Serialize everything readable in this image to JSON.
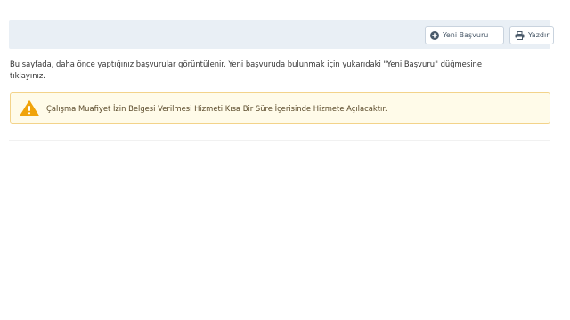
{
  "toolbar": {
    "new_application_label": "Yeni Başvuru",
    "print_label": "Yazdır"
  },
  "icons": {
    "new_application": "plus-circle-icon",
    "print": "printer-icon",
    "warning": "warning-triangle-icon"
  },
  "intro": {
    "line1": "Bu sayfada, daha önce yaptığınız başvurular görüntülenir. Yeni başvuruda bulunmak için yukarıdaki \"Yeni Başvuru\" düğmesine",
    "line2": "tıklayınız."
  },
  "alert": {
    "message": "Çalışma Muafiyet İzin Belgesi Verilmesi Hizmeti Kısa Bir Süre İçerisinde Hizmete Açılacaktır."
  },
  "colors": {
    "toolbar_bg": "#e9eff5",
    "button_icon": "#4a5a6a",
    "warning_bg": "#fffbe9",
    "warning_border": "#f3d38a",
    "warning_icon": "#f0a30a"
  }
}
